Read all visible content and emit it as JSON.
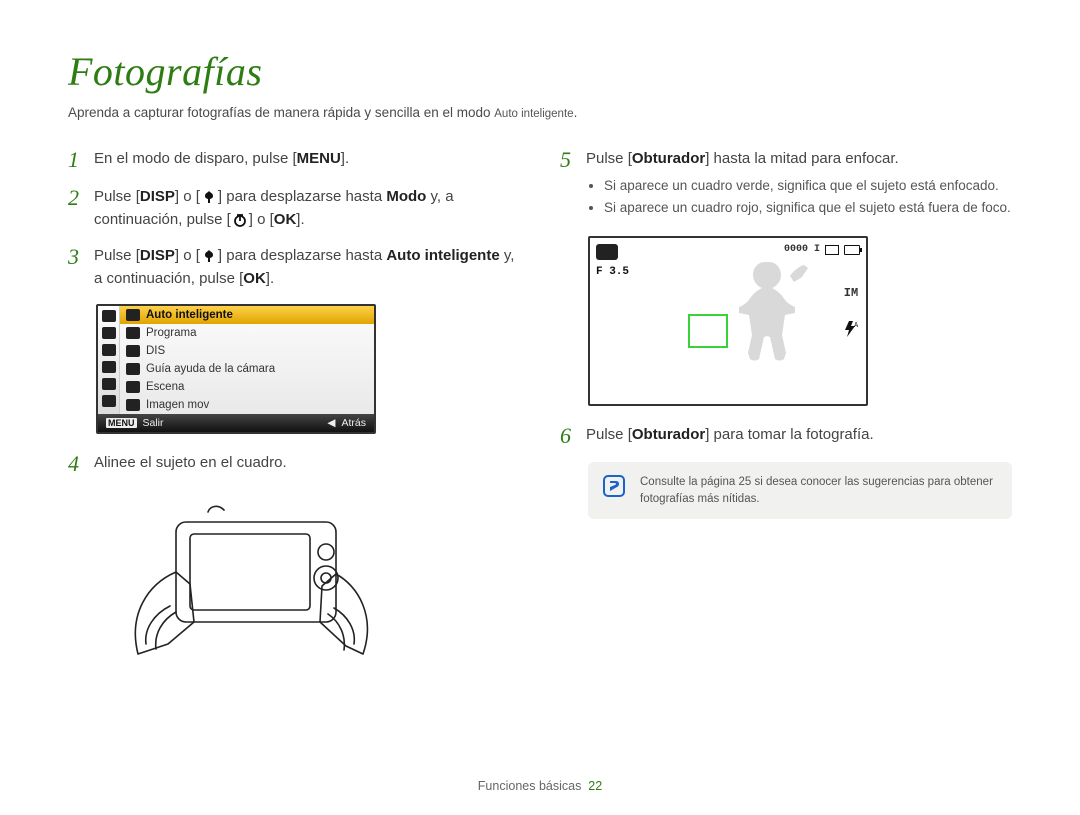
{
  "title": "Fotografías",
  "intro_before": "Aprenda a capturar fotografías de manera rápida y sencilla en el modo ",
  "intro_mode": "Auto inteligente",
  "intro_after": ".",
  "steps": {
    "s1": {
      "num": "1",
      "text_a": "En el modo de disparo, pulse [",
      "btn": "MENU",
      "text_b": "]."
    },
    "s2": {
      "num": "2",
      "text_a": "Pulse [",
      "btn1": "DISP",
      "text_b": "] o [",
      "text_c": "] para desplazarse hasta ",
      "bold1": "Modo",
      "text_d": " y, a continuación, pulse [",
      "text_e": "] o [",
      "btn2": "OK",
      "text_f": "]."
    },
    "s3": {
      "num": "3",
      "text_a": "Pulse [",
      "btn1": "DISP",
      "text_b": "] o [",
      "text_c": "] para desplazarse hasta ",
      "bold1": "Auto inteligente",
      "text_d": " y, a continuación, pulse [",
      "btn2": "OK",
      "text_e": "]."
    },
    "s4": {
      "num": "4",
      "text": "Alinee el sujeto en el cuadro."
    },
    "s5": {
      "num": "5",
      "text_a": "Pulse [",
      "bold1": "Obturador",
      "text_b": "] hasta la mitad para enfocar.",
      "bullets": [
        "Si aparece un cuadro verde, significa que el sujeto está enfocado.",
        "Si aparece un cuadro rojo, significa que el sujeto está fuera de foco."
      ]
    },
    "s6": {
      "num": "6",
      "text_a": "Pulse [",
      "bold1": "Obturador",
      "text_b": "] para tomar la fotografía."
    }
  },
  "menu": {
    "items": [
      "Auto inteligente",
      "Programa",
      "DIS",
      "Guía ayuda de la cámara",
      "Escena",
      "Imagen mov"
    ],
    "footer_left_tag": "MENU",
    "footer_left": "Salir",
    "footer_right_arrow": "◀",
    "footer_right": "Atrás"
  },
  "focus": {
    "f_value": "F 3.5",
    "counter": "0000 I",
    "right_label": "IM"
  },
  "note": "Consulte la página 25 si desea conocer las sugerencias para obtener fotografías más nítidas.",
  "footer_section": "Funciones básicas",
  "footer_page": "22"
}
